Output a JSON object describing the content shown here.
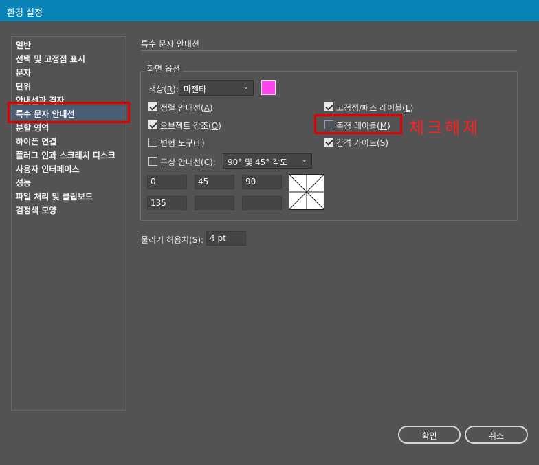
{
  "window": {
    "title": "환경 설정"
  },
  "sidebar": {
    "items": [
      {
        "label": "일반"
      },
      {
        "label": "선택 및 고정점 표시"
      },
      {
        "label": "문자"
      },
      {
        "label": "단위"
      },
      {
        "label": "안내선과 격자"
      },
      {
        "label": "특수 문자 안내선"
      },
      {
        "label": "분할 영역"
      },
      {
        "label": "하이픈 연결"
      },
      {
        "label": "플러그 인과 스크래치 디스크"
      },
      {
        "label": "사용자 인터페이스"
      },
      {
        "label": "성능"
      },
      {
        "label": "파일 처리 및 클립보드"
      },
      {
        "label": "검정색 모양"
      }
    ],
    "selected": "특수 문자 안내선"
  },
  "main": {
    "section_title": "특수 문자 안내선",
    "display_options": {
      "group_label": "화면 옵션",
      "color": {
        "label_prefix": "색상(",
        "mnemonic": "R",
        "label_suffix": "):",
        "value": "마젠타",
        "swatch_color": "#ff44f0"
      },
      "align_guides": {
        "prefix": "정렬 안내선(",
        "mnemonic": "A",
        "suffix": ")",
        "checked": true
      },
      "object_highlight": {
        "prefix": "오브젝트 강조(",
        "mnemonic": "O",
        "suffix": ")",
        "checked": true
      },
      "transform_tools": {
        "prefix": "변형 도구(",
        "mnemonic": "T",
        "suffix": ")",
        "checked": false
      },
      "construction_guides": {
        "prefix": "구성 안내선(",
        "mnemonic": "C",
        "suffix": "):",
        "checked": false,
        "value": "90° 및 45° 각도"
      },
      "anchor_labels": {
        "prefix": "고정점/패스 레이블(",
        "mnemonic": "L",
        "suffix": ")",
        "checked": true
      },
      "measurement_labels": {
        "prefix": "측정 레이블(",
        "mnemonic": "M",
        "suffix": ")",
        "checked": false
      },
      "spacing_guides": {
        "prefix": "간격 가이드(",
        "mnemonic": "S",
        "suffix": ")",
        "checked": true
      },
      "angles": [
        "0",
        "45",
        "90",
        "135",
        "",
        ""
      ]
    },
    "snapping_tolerance": {
      "prefix": "물리기 허용치(",
      "mnemonic": "S",
      "suffix": "):",
      "value": "4 pt"
    }
  },
  "annotation": {
    "text": "체크해제",
    "color": "#ff2020"
  },
  "buttons": {
    "ok": "확인",
    "cancel": "취소"
  },
  "colors": {
    "titlebar": "#0a84b6",
    "background": "#535353",
    "highlight_box": "#e10000",
    "selected_item": "#4a5e76"
  }
}
